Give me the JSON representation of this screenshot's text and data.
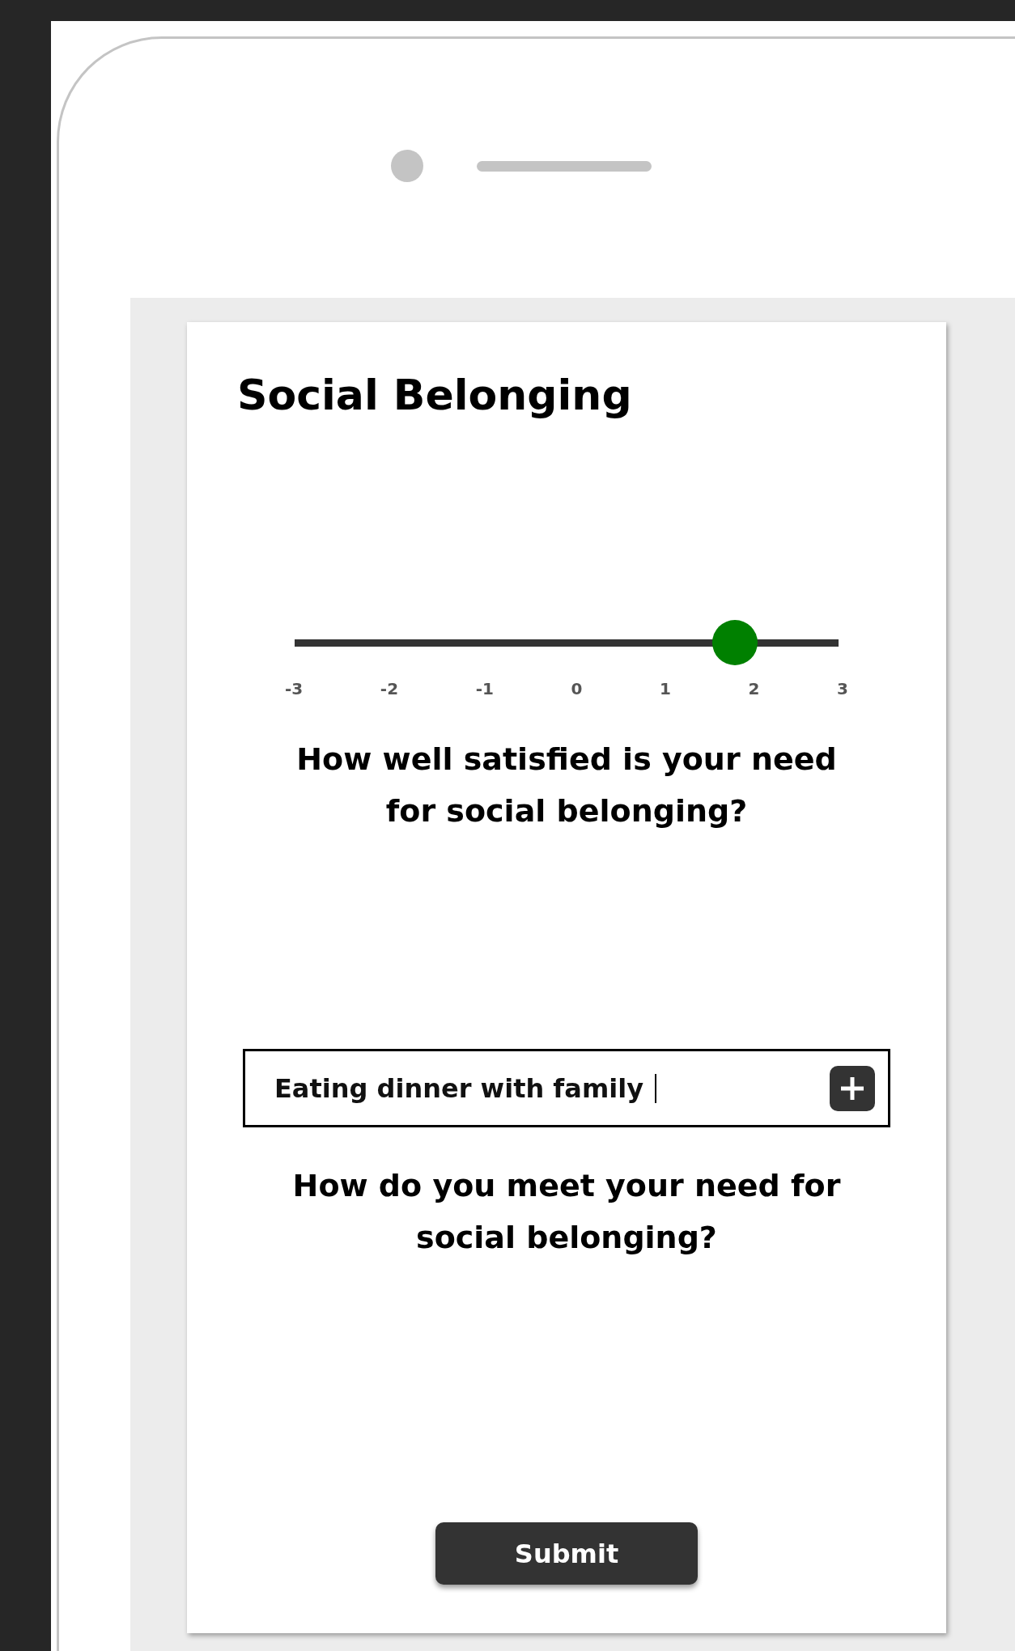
{
  "title": "Social Belonging",
  "slider": {
    "level": 0.81,
    "ticks": [
      "-3",
      "-2",
      "-1",
      "0",
      "1",
      "2",
      "3"
    ]
  },
  "question_1": "How well satisfied is your need for social belonging?",
  "entry_field": {
    "value": "Eating dinner with family"
  },
  "question_2": "How do you meet your need for social belonging?",
  "submit_button": "Submit"
}
